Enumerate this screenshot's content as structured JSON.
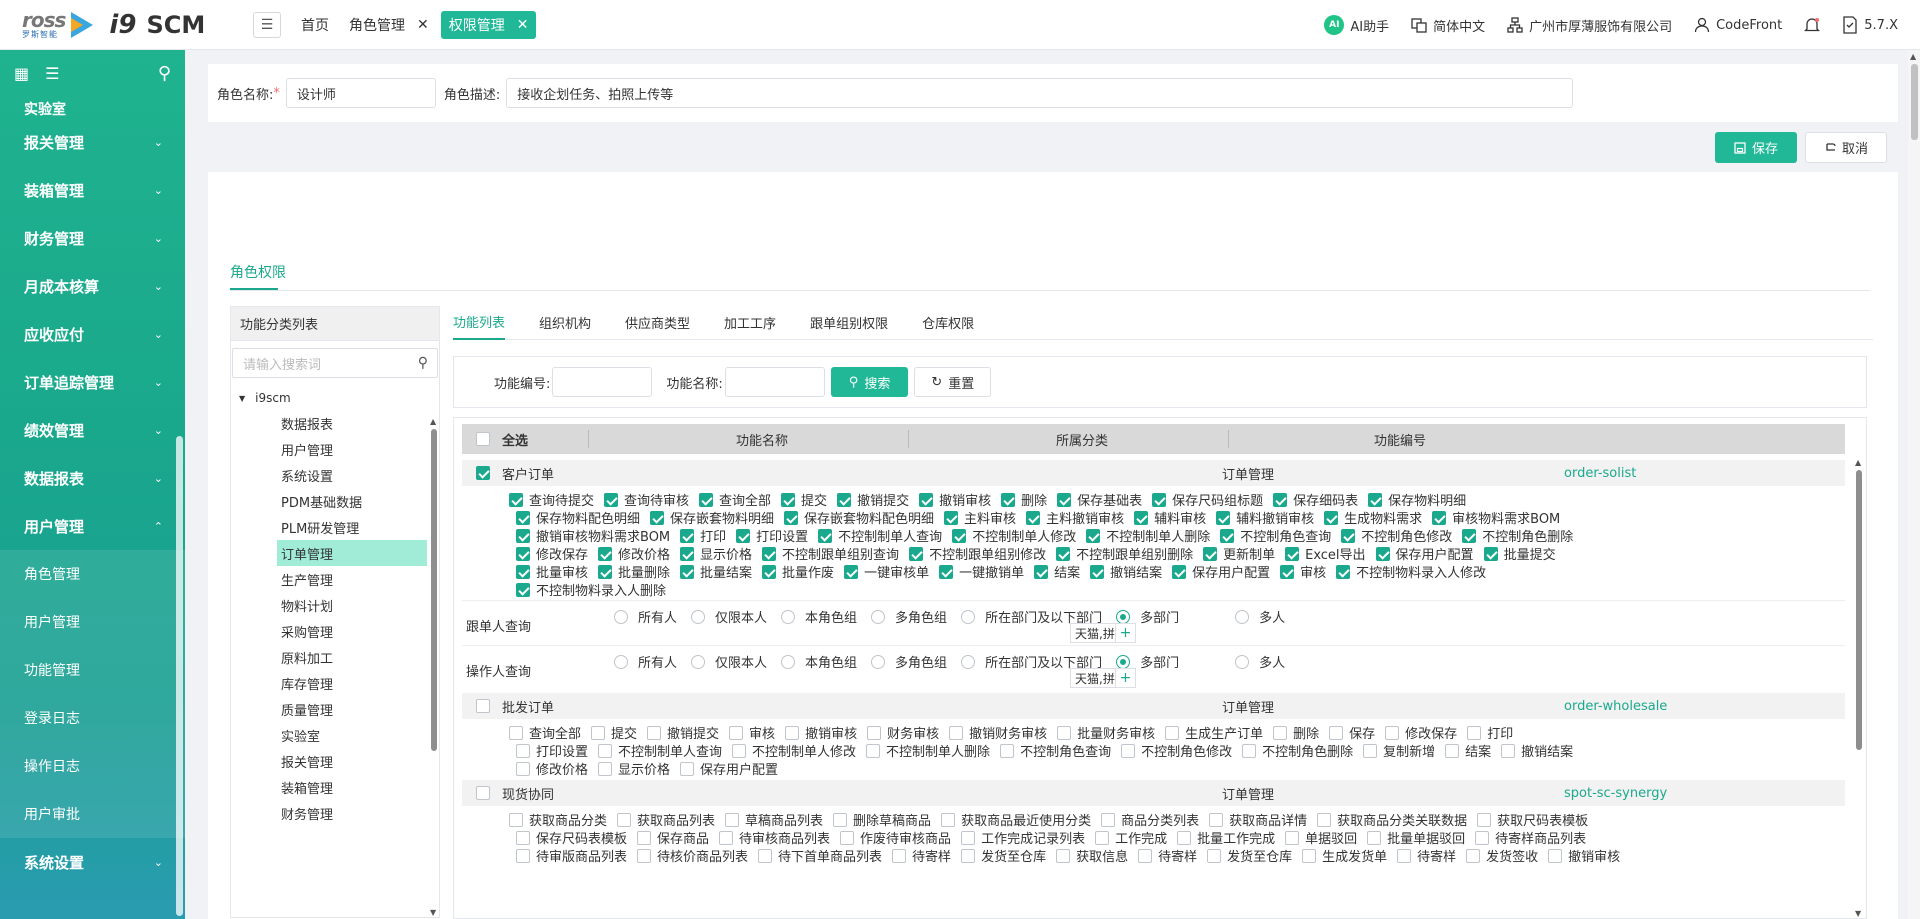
{
  "brand": {
    "logo_text": "ross",
    "logo_sub": "罗斯智能",
    "i9": "i9",
    "scm": "SCM"
  },
  "tabs": [
    {
      "label": "首页",
      "closable": false,
      "active": false
    },
    {
      "label": "角色管理",
      "closable": true,
      "active": false
    },
    {
      "label": "权限管理",
      "closable": true,
      "active": true
    }
  ],
  "topright": {
    "ai": "AI助手",
    "ai_badge": "AI",
    "lang": "简体中文",
    "company": "广州市厚薄服饰有限公司",
    "user": "CodeFront",
    "version": "5.7.X"
  },
  "sidebar": {
    "partial_top": "实验室",
    "items_top": [
      "报关管理",
      "装箱管理",
      "财务管理",
      "月成本核算",
      "应收应付",
      "订单追踪管理",
      "绩效管理",
      "数据报表"
    ],
    "expanded": "用户管理",
    "subitems": [
      "角色管理",
      "用户管理",
      "功能管理",
      "登录日志",
      "操作日志",
      "用户审批"
    ],
    "items_bottom": [
      "系统设置"
    ]
  },
  "form": {
    "role_name_label": "角色名称:",
    "role_name_value": "设计师",
    "role_desc_label": "角色描述:",
    "role_desc_value": "接收企划任务、拍照上传等"
  },
  "actions": {
    "save": "保存",
    "cancel": "取消"
  },
  "role_tab": "角色权限",
  "category": {
    "title": "功能分类列表",
    "search_placeholder": "请输入搜索词",
    "root": "i9scm",
    "nodes": [
      "数据报表",
      "用户管理",
      "系统设置",
      "PDM基础数据",
      "PLM研发管理",
      "订单管理",
      "生产管理",
      "物料计划",
      "采购管理",
      "原料加工",
      "库存管理",
      "质量管理",
      "实验室",
      "报关管理",
      "装箱管理",
      "财务管理"
    ],
    "selected": "订单管理"
  },
  "func_tabs": [
    "功能列表",
    "组织机构",
    "供应商类型",
    "加工工序",
    "跟单组别权限",
    "仓库权限"
  ],
  "filter": {
    "code_label": "功能编号:",
    "name_label": "功能名称:",
    "search": "搜索",
    "reset": "重置"
  },
  "table": {
    "headers": {
      "select_all": "全选",
      "name": "功能名称",
      "category": "所属分类",
      "code": "功能编号"
    },
    "groups": [
      {
        "name": "客户订单",
        "category": "订单管理",
        "code": "order-solist",
        "checked": true,
        "rows": [
          [
            "查询待提交",
            "查询待审核",
            "查询全部",
            "提交",
            "撤销提交",
            "撤销审核",
            "删除",
            "保存基础表",
            "保存尺码组标题",
            "保存细码表",
            "保存物料明细"
          ],
          [
            "保存物料配色明细",
            "保存嵌套物料明细",
            "保存嵌套物料配色明细",
            "主料审核",
            "主料撤销审核",
            "辅料审核",
            "辅料撤销审核",
            "生成物料需求",
            "审核物料需求BOM"
          ],
          [
            "撤销审核物料需求BOM",
            "打印",
            "打印设置",
            "不控制制单人查询",
            "不控制制单人修改",
            "不控制制单人删除",
            "不控制角色查询",
            "不控制角色修改",
            "不控制角色删除"
          ],
          [
            "修改保存",
            "修改价格",
            "显示价格",
            "不控制跟单组别查询",
            "不控制跟单组别修改",
            "不控制跟单组别删除",
            "更新制单",
            "Excel导出",
            "保存用户配置",
            "批量提交"
          ],
          [
            "批量审核",
            "批量删除",
            "批量结案",
            "批量作废",
            "一键审核单",
            "一键撤销单",
            "结案",
            "撤销结案",
            "保存用户配置",
            "审核",
            "不控制物料录入人修改"
          ],
          [
            "不控制物料录入人删除"
          ]
        ]
      },
      {
        "name": "批发订单",
        "category": "订单管理",
        "code": "order-wholesale",
        "checked": false,
        "rows": [
          [
            "查询全部",
            "提交",
            "撤销提交",
            "审核",
            "撤销审核",
            "财务审核",
            "撤销财务审核",
            "批量财务审核",
            "生成生产订单",
            "删除",
            "保存",
            "修改保存",
            "打印"
          ],
          [
            "打印设置",
            "不控制制单人查询",
            "不控制制单人修改",
            "不控制制单人删除",
            "不控制角色查询",
            "不控制角色修改",
            "不控制角色删除",
            "复制新增",
            "结案",
            "撤销结案"
          ],
          [
            "修改价格",
            "显示价格",
            "保存用户配置"
          ]
        ]
      },
      {
        "name": "现货协同",
        "category": "订单管理",
        "code": "spot-sc-synergy",
        "checked": false,
        "rows": [
          [
            "获取商品分类",
            "获取商品列表",
            "草稿商品列表",
            "删除草稿商品",
            "获取商品最近使用分类",
            "商品分类列表",
            "获取商品详情",
            "获取商品分类关联数据",
            "获取尺码表模板"
          ],
          [
            "保存尺码表模板",
            "保存商品",
            "待审核商品列表",
            "作废待审核商品",
            "工作完成记录列表",
            "工作完成",
            "批量工作完成",
            "单据驳回",
            "批量单据驳回",
            "待寄样商品列表"
          ],
          [
            "待审版商品列表",
            "待核价商品列表",
            "待下首单商品列表",
            "待寄样",
            "发货至仓库",
            "获取信息",
            "待寄样",
            "发货至仓库",
            "生成发货单",
            "待寄样",
            "发货签收",
            "撤销审核"
          ]
        ]
      }
    ],
    "radio_options": [
      "所有人",
      "仅限本人",
      "本角色组",
      "多角色组",
      "所在部门及以下部门",
      "多部门",
      "多人"
    ],
    "radio_rows": [
      {
        "label": "跟单人查询",
        "selected": "多部门",
        "dept": "天猫,拼"
      },
      {
        "label": "操作人查询",
        "selected": "多部门",
        "dept": "天猫,拼"
      }
    ]
  }
}
